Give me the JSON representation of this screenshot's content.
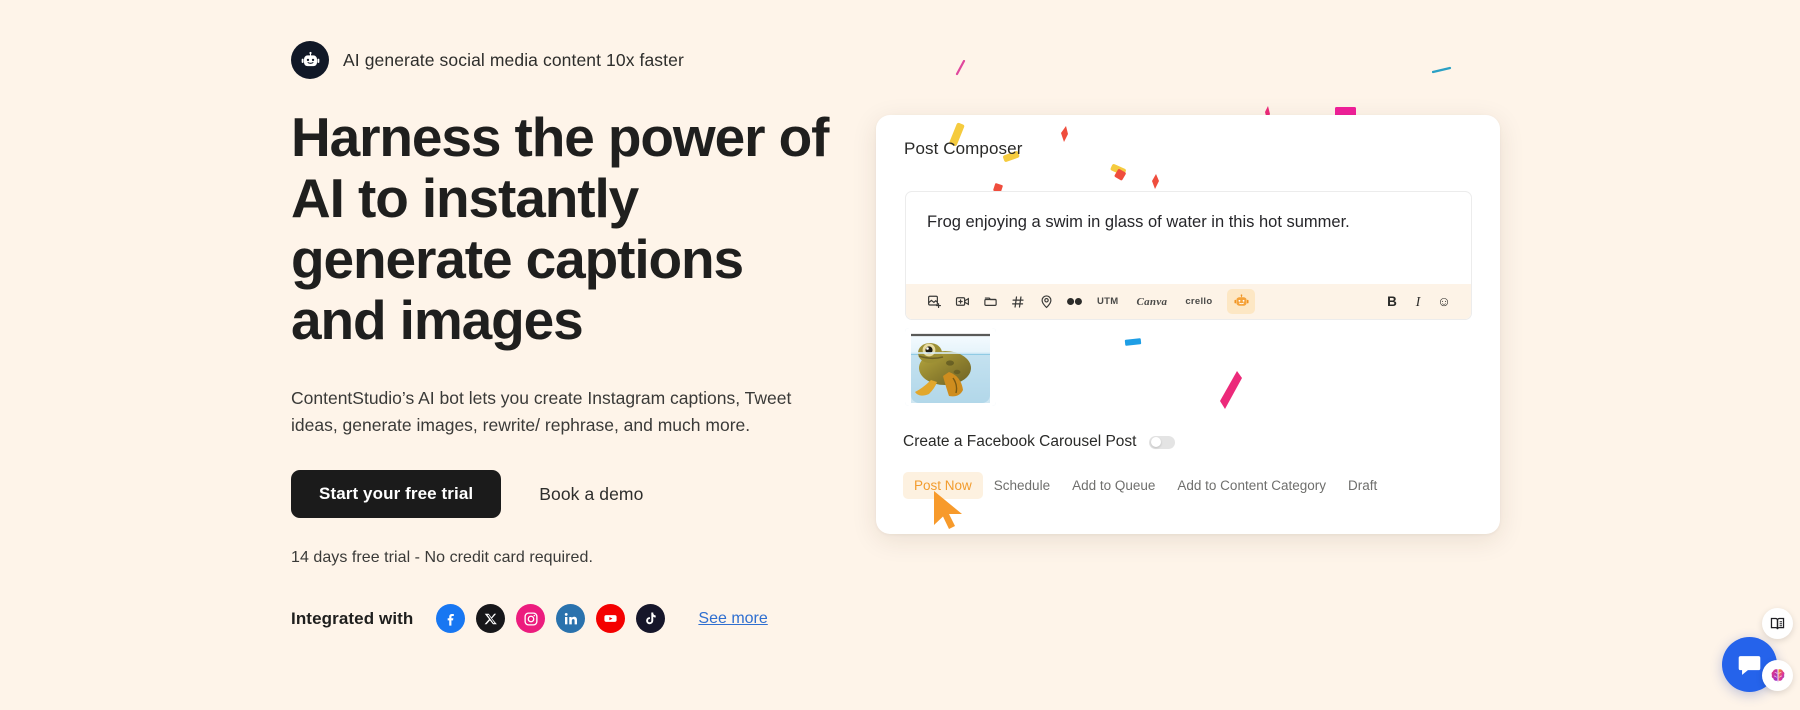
{
  "theme": {
    "background": "#fef4e9",
    "text_dark": "#1f1f1e",
    "accent_orange": "#f29c2e",
    "link_blue": "#2f6fd0",
    "button_dark": "#1b1b1b"
  },
  "hero": {
    "eyebrow": {
      "icon": "robot-icon",
      "text": "AI generate social media content 10x faster"
    },
    "headline": "Harness the power of AI to instantly generate captions and images",
    "subcopy": "ContentStudio’s AI bot lets you create Instagram captions, Tweet ideas, generate images, rewrite/ rephrase, and much more.",
    "primary_cta": "Start your free trial",
    "secondary_cta": "Book a demo",
    "trial_note": "14 days free trial - No credit card required.",
    "integrated": {
      "label": "Integrated with",
      "see_more": "See more",
      "networks": [
        {
          "name": "facebook",
          "icon": "facebook-icon",
          "color": "#1877f2"
        },
        {
          "name": "x",
          "icon": "x-twitter-icon",
          "color": "#17171a"
        },
        {
          "name": "instagram",
          "icon": "instagram-icon",
          "color": "#ec1c7e"
        },
        {
          "name": "linkedin",
          "icon": "linkedin-icon",
          "color": "#2a72ad"
        },
        {
          "name": "youtube",
          "icon": "youtube-icon",
          "color": "#f40000"
        },
        {
          "name": "tiktok",
          "icon": "tiktok-icon",
          "color": "#16162a"
        }
      ]
    }
  },
  "composer": {
    "title": "Post Composer",
    "editor_text": "Frog enjoying a swim in glass of water in this hot summer.",
    "toolbar_left": [
      {
        "name": "add-image",
        "icon": "image-plus-icon",
        "type": "icon"
      },
      {
        "name": "add-video",
        "icon": "video-plus-icon",
        "type": "icon"
      },
      {
        "name": "media-folder",
        "icon": "folder-icon",
        "type": "icon"
      },
      {
        "name": "hashtag",
        "icon": "hashtag-icon",
        "type": "icon"
      },
      {
        "name": "location",
        "icon": "location-pin-icon",
        "type": "icon"
      },
      {
        "name": "link-shortener",
        "icon": "infinity-icon",
        "type": "icon"
      },
      {
        "name": "utm",
        "icon": "utm-label",
        "type": "label",
        "label": "UTM"
      },
      {
        "name": "canva",
        "icon": "canva-label",
        "type": "script",
        "label": "Canva"
      },
      {
        "name": "crello",
        "icon": "crello-label",
        "type": "crello",
        "label": "crello"
      }
    ],
    "ai_button": {
      "name": "ai-assistant",
      "icon": "robot-icon",
      "active": true
    },
    "toolbar_right": [
      {
        "name": "bold",
        "icon": "bold-icon",
        "label": "B"
      },
      {
        "name": "italic",
        "icon": "italic-icon",
        "label": "I"
      },
      {
        "name": "emoji",
        "icon": "smiley-icon",
        "label": "☺"
      }
    ],
    "attachment": {
      "name": "frog-in-glass-thumbnail",
      "alt": "Frog enjoying a swim in a glass of water"
    },
    "carousel_label": "Create a Facebook Carousel Post",
    "carousel_toggle": "off",
    "tabs": [
      {
        "label": "Post Now",
        "active": true
      },
      {
        "label": "Schedule",
        "active": false
      },
      {
        "label": "Add to Queue",
        "active": false
      },
      {
        "label": "Add to Content Category",
        "active": false
      },
      {
        "label": "Draft",
        "active": false
      }
    ]
  },
  "widgets": {
    "chat": {
      "name": "chat-widget",
      "icon": "chat-bubble-icon",
      "color": "#2563eb"
    },
    "docs": {
      "name": "docs-widget",
      "icon": "book-icon"
    },
    "ai": {
      "name": "ai-widget",
      "icon": "brain-icon"
    }
  }
}
